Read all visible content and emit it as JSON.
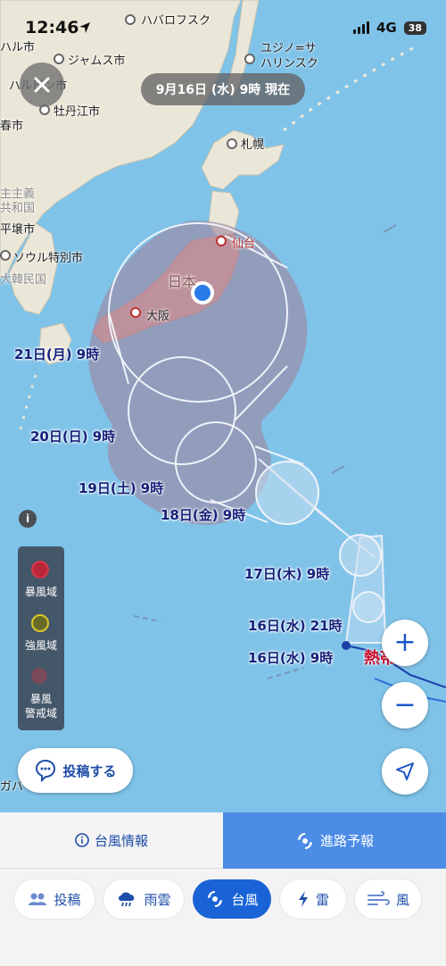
{
  "status_bar": {
    "time": "12:46",
    "network": "4G",
    "battery": "38"
  },
  "map": {
    "date_label": "9月16日 (水) 9時 現在",
    "places": {
      "khabarovsk": "ハバロフスク",
      "harbin_left": "ハル市",
      "jiamusi": "ジャムス市",
      "harbin": "ハルビン市",
      "mudanjiang": "牡丹江市",
      "changchun": "春市",
      "yuzhno1": "ユジノ=サ",
      "yuzhno2": "ハリンスク",
      "sapporo": "札幌",
      "dprk1": "主主義",
      "dprk2": "共和国",
      "pyongyang": "平壌市",
      "seoul": "ソウル特別市",
      "rok": "大韓民国",
      "sendai": "仙台",
      "japan": "日本",
      "osaka": "大阪",
      "bottom_left": "ガバ"
    },
    "track_labels": {
      "d21": "21日(月) 9時",
      "d20": "20日(日) 9時",
      "d19": "19日(土) 9時",
      "d18": "18日(金) 9時",
      "d17": "17日(木) 9時",
      "d16pm": "16日(水) 21時",
      "d16am": "16日(水) 9時"
    },
    "storm_label": "熱帯低"
  },
  "legend": {
    "storm_zone": "暴風域",
    "strong_zone": "強風域",
    "warning_zone_1": "暴風",
    "warning_zone_2": "警戒域"
  },
  "buttons": {
    "post": "投稿する",
    "info": "i",
    "zoom_in": "+",
    "zoom_out": "−"
  },
  "tabs": {
    "info": "台風情報",
    "forecast": "進路予報"
  },
  "bottom_nav": {
    "post": "投稿",
    "rain": "雨雲",
    "typhoon": "台風",
    "thunder": "雷",
    "wind": "風"
  },
  "icons": {
    "close": "close-icon",
    "location": "navigation-arrow-icon",
    "info": "info-icon",
    "typhoon": "typhoon-icon"
  },
  "colors": {
    "sea": "#7fc3e9",
    "land": "#ebe7d8",
    "japan_land": "#f2a597",
    "warning_zone": "#9e86a0",
    "track_text": "#16207a",
    "accent": "#1a63d6",
    "storm_zone_legend": "#c0283c",
    "strong_zone_legend": "#d8c82c"
  }
}
